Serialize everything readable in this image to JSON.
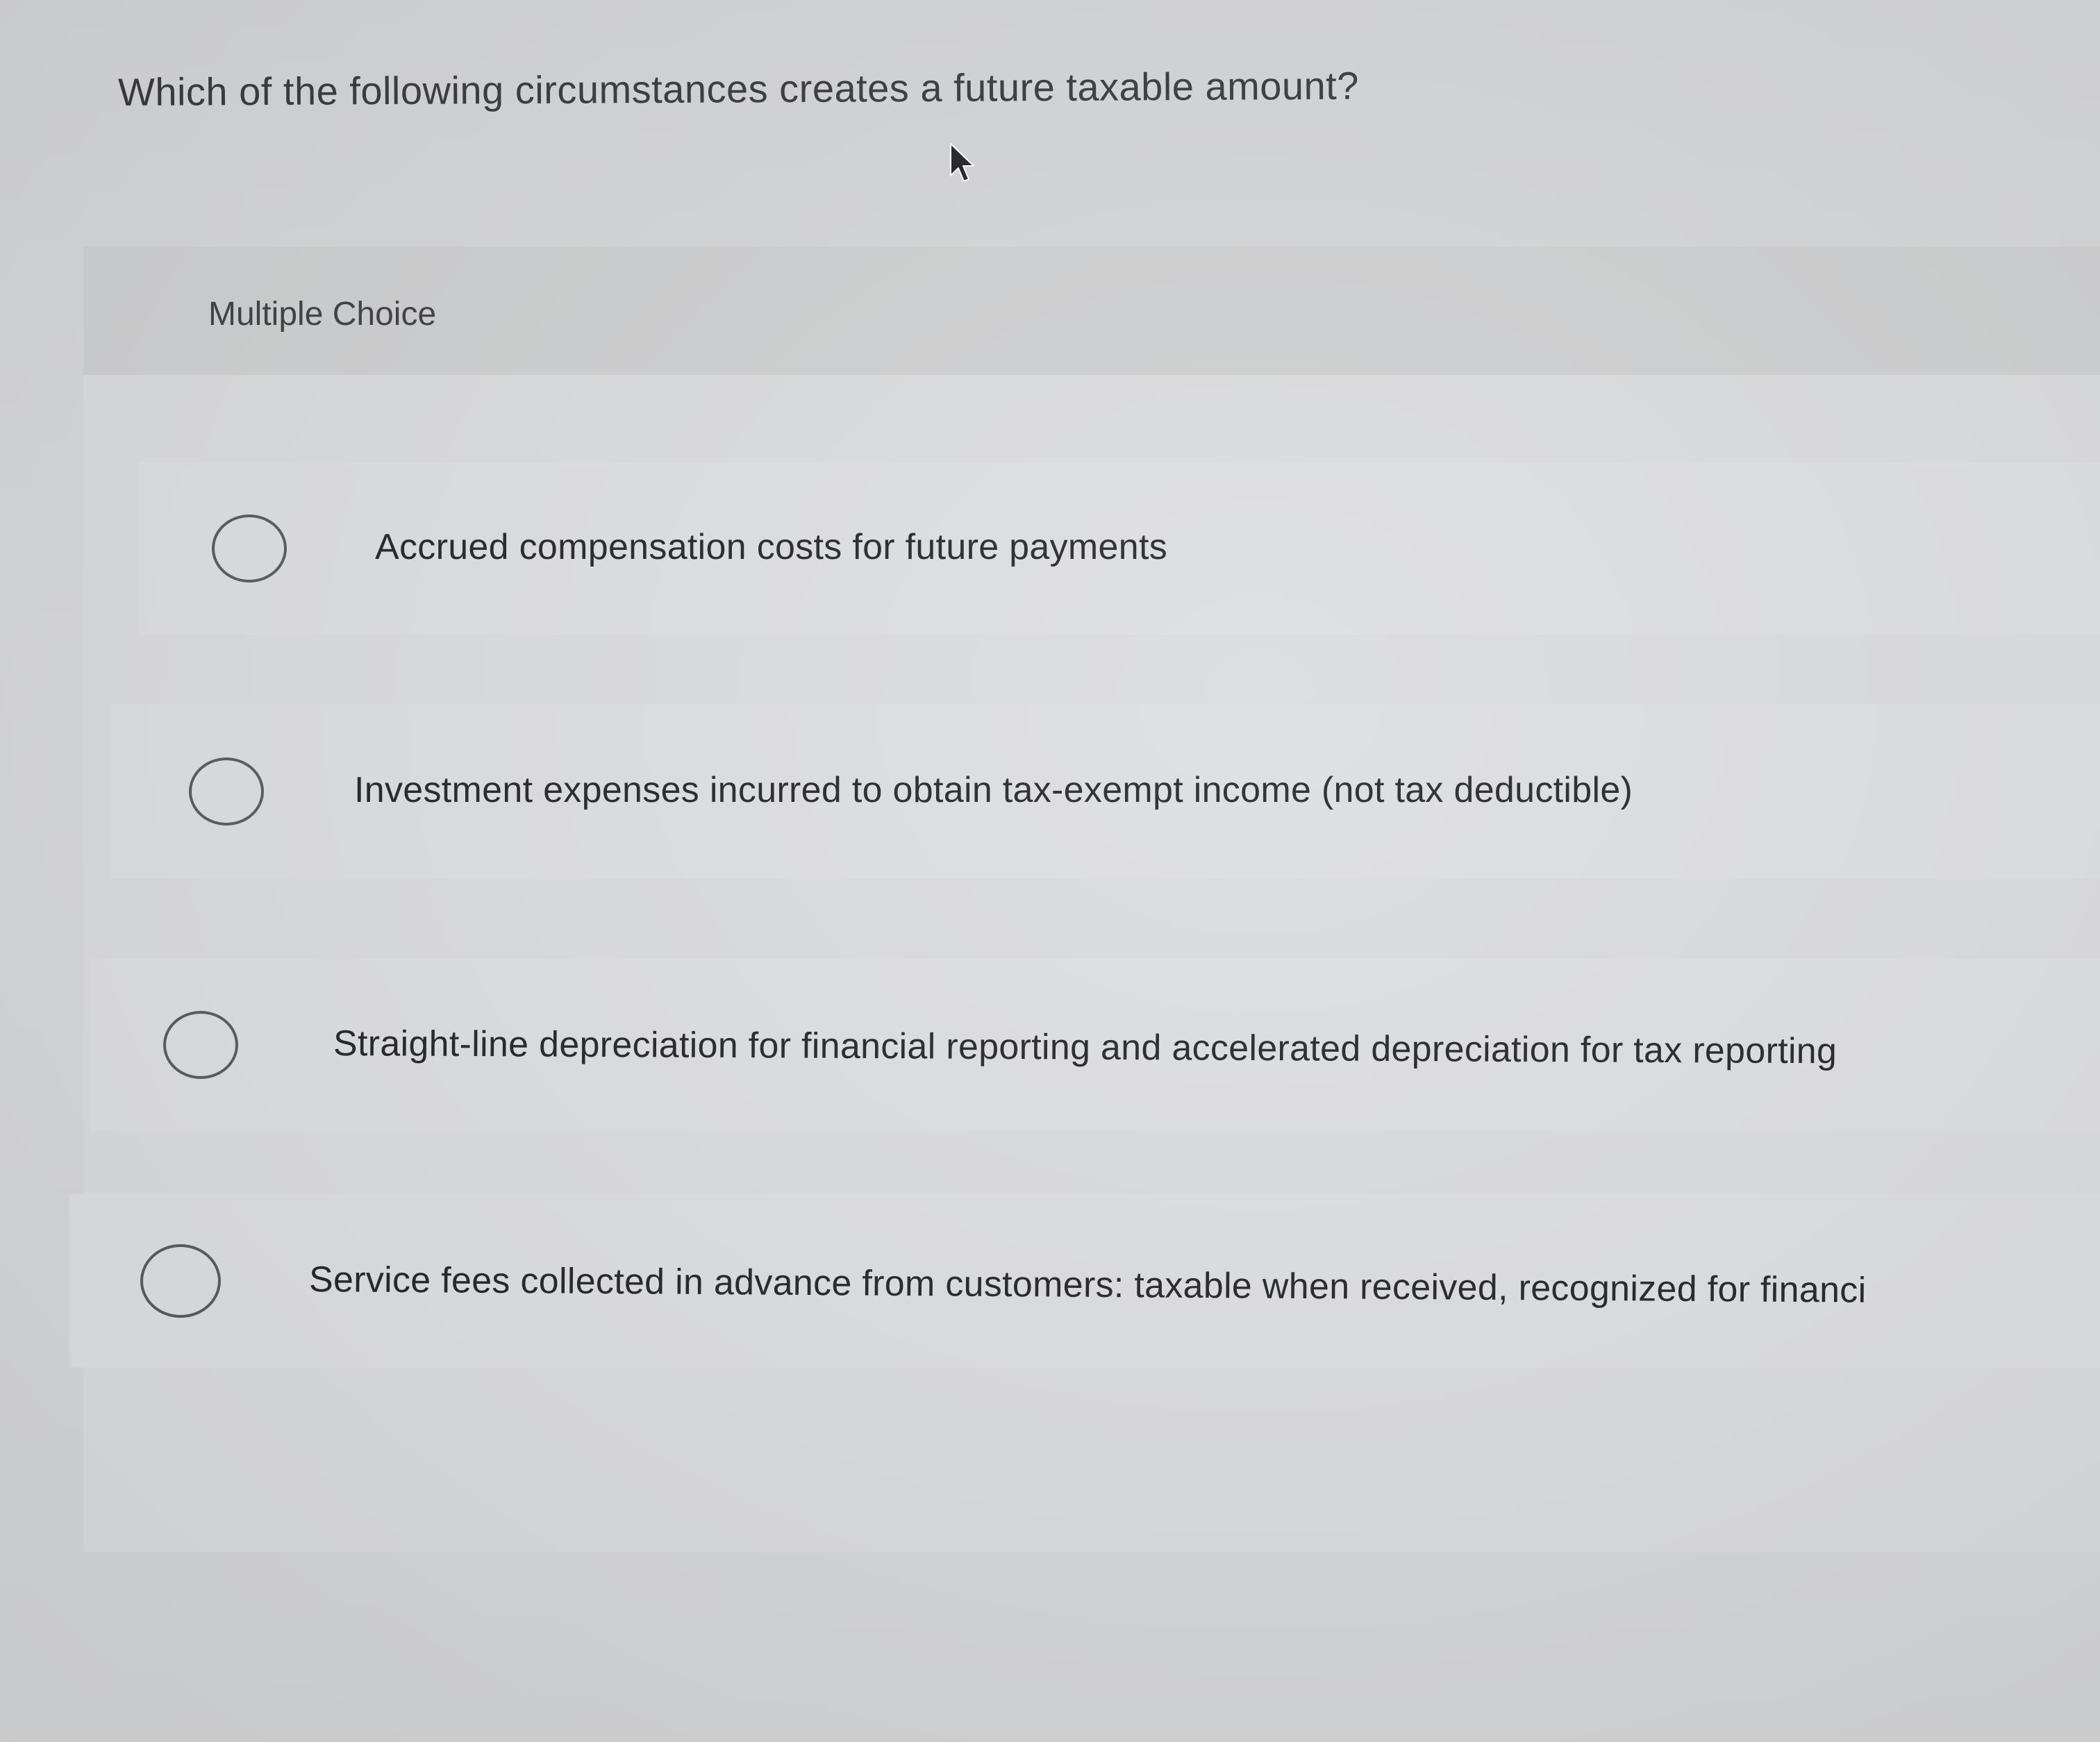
{
  "question": {
    "text": "Which of the following circumstances creates a future taxable amount?"
  },
  "multiple_choice": {
    "label": "Multiple Choice",
    "options": [
      {
        "label": "Accrued compensation costs for future payments",
        "selected": false
      },
      {
        "label": "Investment expenses incurred to obtain tax-exempt income (not tax deductible)",
        "selected": false
      },
      {
        "label": "Straight-line depreciation for financial reporting and accelerated depreciation for tax reporting",
        "selected": false
      },
      {
        "label": "Service fees collected in advance from customers: taxable when received, recognized for financi",
        "selected": false
      }
    ]
  },
  "colors": {
    "background": "#d4d5d7",
    "header_band": "#cdcecf",
    "text": "#1f2023",
    "radio_border": "#55575b"
  },
  "icons": {
    "cursor": "mouse-pointer-icon",
    "radio": "radio-button-unchecked-icon"
  }
}
